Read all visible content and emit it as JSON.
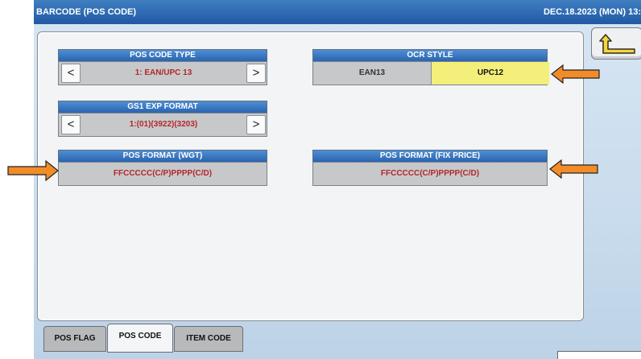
{
  "header": {
    "title": "BARCODE (POS CODE)",
    "datetime": "DEC.18.2023 (MON)  13:"
  },
  "pos_code_type": {
    "label": "POS CODE TYPE",
    "value": "1: EAN/UPC 13",
    "prev": "<",
    "next": ">"
  },
  "ocr_style": {
    "label": "OCR STYLE",
    "options": [
      "EAN13",
      "UPC12"
    ],
    "selected": "UPC12"
  },
  "gs1_exp_format": {
    "label": "GS1 EXP FORMAT",
    "value": "1:(01)(3922)(3203)",
    "prev": "<",
    "next": ">"
  },
  "pos_format_wgt": {
    "label": "POS FORMAT (WGT)",
    "value": "FFCCCCC(C/P)PPPP(C/D)"
  },
  "pos_format_fix_price": {
    "label": "POS FORMAT (FIX PRICE)",
    "value": "FFCCCCC(C/P)PPPP(C/D)"
  },
  "tabs": [
    {
      "label": "POS FLAG",
      "active": false
    },
    {
      "label": "POS CODE",
      "active": true
    },
    {
      "label": "ITEM CODE",
      "active": false
    }
  ],
  "colors": {
    "accent_orange": "#f28c28",
    "header_blue": "#2a64b0",
    "value_red": "#b4262b",
    "selected_yellow": "#f3ef7a"
  },
  "icons": {
    "back": "return-arrow-icon",
    "callout": "orange-arrow-icon"
  }
}
